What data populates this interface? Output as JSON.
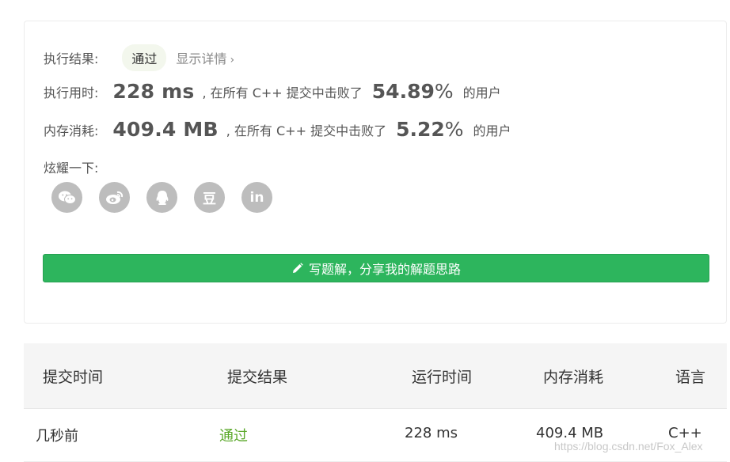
{
  "result": {
    "label": "执行结果:",
    "status": "通过",
    "details_link": "显示详情",
    "details_chevron": "›"
  },
  "runtime": {
    "label": "执行用时:",
    "value": "228 ms",
    "beat_text": ", 在所有 C++ 提交中击败了",
    "percent": "54.89",
    "percent_sign": "%",
    "suffix": "的用户"
  },
  "memory": {
    "label": "内存消耗:",
    "value": "409.4 MB",
    "beat_text": ", 在所有 C++ 提交中击败了",
    "percent": "5.22",
    "percent_sign": "%",
    "suffix": "的用户"
  },
  "share": {
    "label": "炫耀一下:",
    "icons": [
      "wechat-icon",
      "weibo-icon",
      "qq-icon",
      "douban-icon",
      "linkedin-icon"
    ],
    "douban_glyph": "豆",
    "linkedin_glyph": "in"
  },
  "write_solution": {
    "label": "写题解，分享我的解题思路",
    "icon": "pencil-icon"
  },
  "submissions": {
    "headers": [
      "提交时间",
      "提交结果",
      "运行时间",
      "内存消耗",
      "语言"
    ],
    "rows": [
      {
        "time": "几秒前",
        "result": "通过",
        "runtime": "228 ms",
        "memory": "409.4 MB",
        "language": "C++"
      }
    ]
  },
  "watermark": "https://blog.csdn.net/Fox_Alex",
  "colors": {
    "accent_green": "#2db55d",
    "pass_green": "#5aa829",
    "social_grey": "#bdbdbd",
    "badge_bg": "#f3f7ed"
  }
}
